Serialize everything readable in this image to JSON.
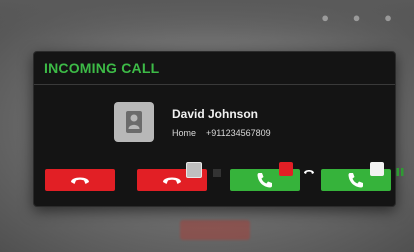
{
  "dialog": {
    "title": "INCOMING CALL",
    "caller": {
      "name": "David Johnson",
      "label": "Home",
      "number": "+911234567809"
    }
  },
  "actions": [
    {
      "name": "decline",
      "icon": "phone-hangup-icon",
      "color": "#e21f25"
    },
    {
      "name": "decline-and-stop",
      "icon": "phone-hangup-icon",
      "badge": "stop-icon",
      "color": "#e21f25"
    },
    {
      "name": "answer-and-end",
      "icon": "phone-icon",
      "badge": "phone-hangup-icon",
      "color": "#36b33b"
    },
    {
      "name": "answer-and-hold",
      "icon": "phone-icon",
      "badge": "pause-icon",
      "color": "#36b33b"
    }
  ],
  "colors": {
    "accent": "#3dbb47",
    "decline": "#e21f25",
    "answer": "#36b33b"
  }
}
